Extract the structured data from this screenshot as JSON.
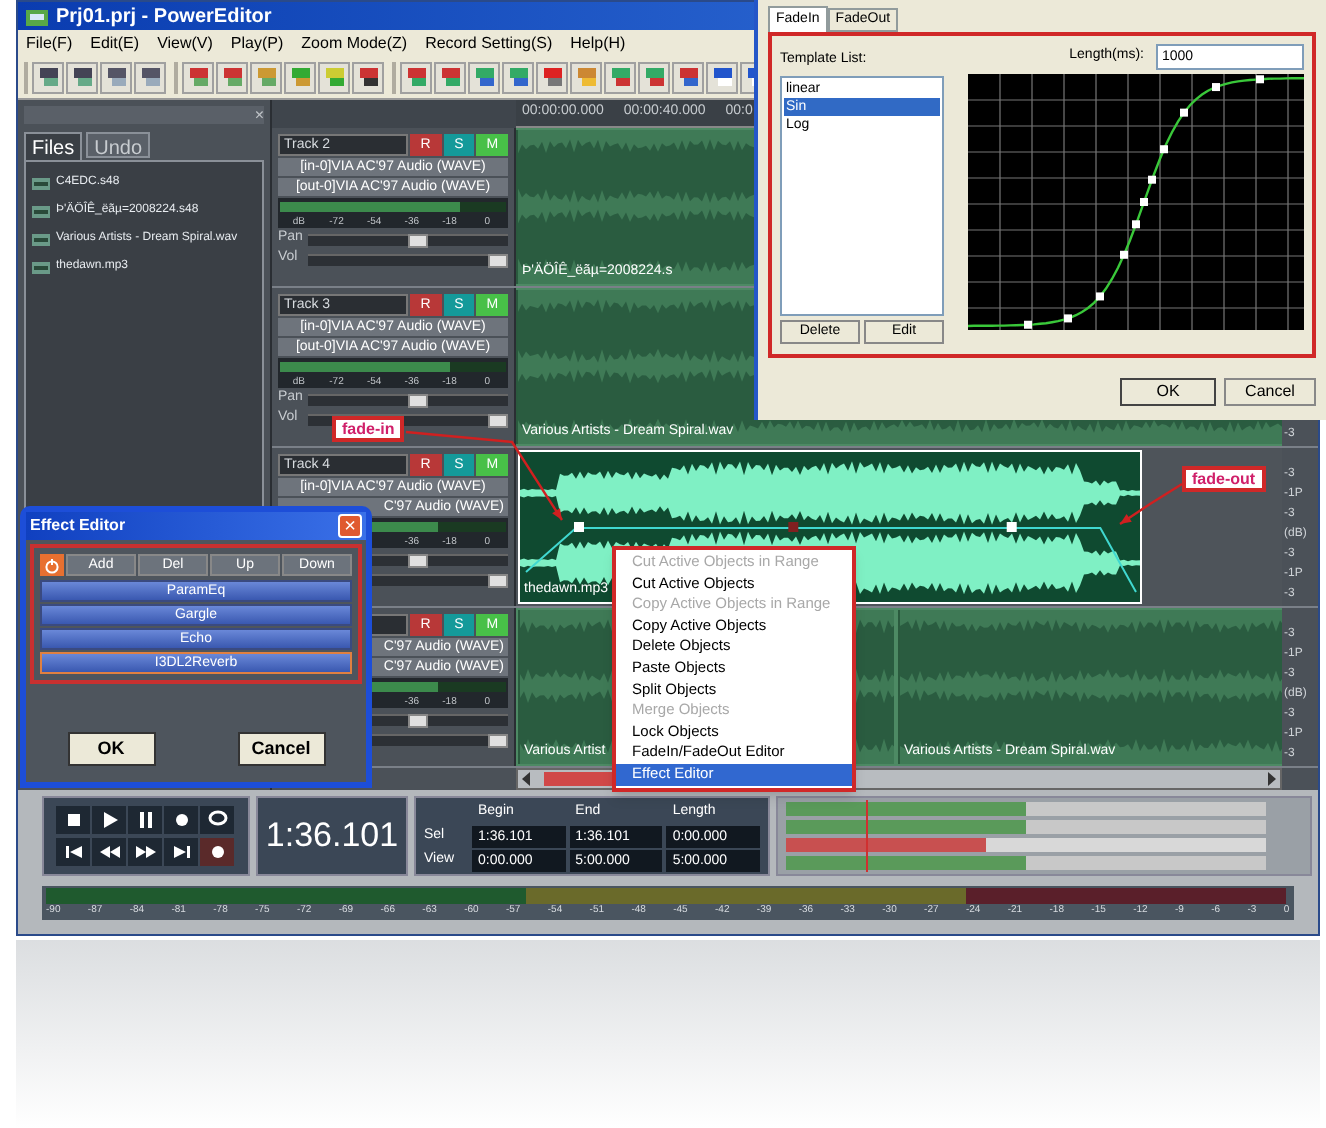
{
  "window": {
    "title": "Prj01.prj - PowerEditor"
  },
  "menu": [
    "File(F)",
    "Edit(E)",
    "View(V)",
    "Play(P)",
    "Zoom Mode(Z)",
    "Record Setting(S)",
    "Help(H)"
  ],
  "left_panel": {
    "close": "×",
    "tabs": [
      {
        "label": "Files",
        "selected": true
      },
      {
        "label": "Undo",
        "selected": false
      }
    ],
    "files": [
      "C4EDC.s48",
      "Þ'ÄÖÎÊ_ëãµ=2008224.s48",
      "Various Artists - Dream Spiral.wav",
      "thedawn.mp3"
    ]
  },
  "ruler": [
    "00:00:00.000",
    "00:00:40.000",
    "00:0"
  ],
  "tracks": [
    {
      "name": "Track 2",
      "buttons": [
        "R",
        "S",
        "M"
      ],
      "in": {
        "text": "[in-0]VIA AC'97 Audio (WAVE)",
        "cut": false
      },
      "out": {
        "text": "[out-0]VIA AC'97 Audio (WAVE)",
        "cut": false
      },
      "scale": [
        "dB",
        "-72",
        "-54",
        "-36",
        "-18",
        "0"
      ],
      "meter": {
        "level": 0.8
      },
      "pan": {
        "label": "Pan",
        "level": 0.55
      },
      "vol": {
        "label": "Vol",
        "level": 0.95
      },
      "clips": [
        {
          "label": "Þ'ÄÖÎÊ_ëãµ=2008224.s",
          "selected": false
        }
      ]
    },
    {
      "name": "Track 3",
      "buttons": [
        "R",
        "S",
        "M"
      ],
      "in": {
        "text": "[in-0]VIA AC'97 Audio (WAVE)",
        "cut": false
      },
      "out": {
        "text": "[out-0]VIA AC'97 Audio (WAVE)",
        "cut": false
      },
      "scale": [
        "dB",
        "-72",
        "-54",
        "-36",
        "-18",
        "0"
      ],
      "meter": {
        "level": 0.75
      },
      "pan": {
        "label": "Pan",
        "level": 0.55
      },
      "vol": {
        "label": "Vol",
        "level": 0.95
      },
      "clips": [
        {
          "label": "Various Artists - Dream Spiral.wav",
          "selected": false
        }
      ],
      "db_scale": [
        "-3"
      ]
    },
    {
      "name": "Track 4",
      "buttons": [
        "R",
        "S",
        "M"
      ],
      "in": {
        "text": "[in-0]VIA AC'97 Audio (WAVE)",
        "cut": false
      },
      "out": {
        "text": "C'97 Audio (WAVE)",
        "cut": true
      },
      "scale": [
        "-36",
        "-18",
        "0"
      ],
      "meter": {
        "level": 0.7
      },
      "pan": {
        "level": 0.55
      },
      "vol": {
        "level": 0.95
      },
      "clips": [
        {
          "label": "thedawn.mp3",
          "selected": true
        }
      ],
      "db_scale": [
        "-3",
        "-1P",
        "-3",
        "(dB)",
        "-3",
        "-1P",
        "-3"
      ]
    },
    {
      "buttons": [
        "R",
        "S",
        "M"
      ],
      "in": {
        "text": "C'97 Audio (WAVE)",
        "cut": true
      },
      "out": {
        "text": "C'97 Audio (WAVE)",
        "cut": true
      },
      "scale": [
        "-36",
        "-18",
        "0"
      ],
      "meter": {
        "level": 0.7
      },
      "pan": {
        "level": 0.55
      },
      "vol": {
        "level": 0.95
      },
      "clips": [
        {
          "label": "Various Artist",
          "selected": false
        },
        {
          "label": "Various Artists - Dream Spiral.wav",
          "selected": false
        }
      ],
      "db_scale": [
        "-3",
        "-1P",
        "-3",
        "(dB)",
        "-3",
        "-1P",
        "-3"
      ]
    }
  ],
  "context_menu": [
    {
      "label": "Cut Active Objects in Range",
      "disabled": true,
      "selected": false
    },
    {
      "label": "Cut Active Objects",
      "disabled": false,
      "selected": false
    },
    {
      "label": "Copy Active Objects in Range",
      "disabled": true,
      "selected": false
    },
    {
      "label": "Copy Active Objects",
      "disabled": false,
      "selected": false
    },
    {
      "label": "Delete Objects",
      "disabled": false,
      "selected": false
    },
    {
      "label": "Paste Objects",
      "disabled": false,
      "selected": false
    },
    {
      "label": "Split Objects",
      "disabled": false,
      "selected": false
    },
    {
      "label": "Merge Objects",
      "disabled": true,
      "selected": false
    },
    {
      "label": "Lock Objects",
      "disabled": false,
      "selected": false
    },
    {
      "label": "FadeIn/FadeOut Editor",
      "disabled": false,
      "selected": false
    },
    {
      "label": "Effect Editor",
      "disabled": false,
      "selected": true
    }
  ],
  "callouts": [
    "fade-in",
    "fade-out"
  ],
  "fade_dialog": {
    "tabs": [
      {
        "label": "FadeIn",
        "selected": true
      },
      {
        "label": "FadeOut",
        "selected": false
      }
    ],
    "template_label": "Template List:",
    "templates": [
      {
        "label": "linear",
        "selected": false
      },
      {
        "label": "Sin",
        "selected": true
      },
      {
        "label": "Log",
        "selected": false
      }
    ],
    "length_label": "Length(ms):",
    "length": "1000",
    "delete": "Delete",
    "edit": "Edit",
    "ok": "OK",
    "cancel": "Cancel"
  },
  "effect_editor": {
    "title": "Effect Editor",
    "close": "×",
    "tools": [
      "Add",
      "Del",
      "Up",
      "Down"
    ],
    "effects": [
      {
        "label": "ParamEq",
        "selected": false
      },
      {
        "label": "Gargle",
        "selected": false
      },
      {
        "label": "Echo",
        "selected": false
      },
      {
        "label": "I3DL2Reverb",
        "selected": true
      }
    ],
    "ok": "OK",
    "cancel": "Cancel"
  },
  "transport": {
    "time": "1:36.101",
    "columns": [
      "Begin",
      "End",
      "Length"
    ],
    "rows": [
      {
        "label": "Sel",
        "values": [
          "1:36.101",
          "1:36.101",
          "0:00.000"
        ]
      },
      {
        "label": "View",
        "values": [
          "0:00.000",
          "5:00.000",
          "5:00.000"
        ]
      }
    ]
  },
  "level_meter": {
    "scale": [
      "-90",
      "-87",
      "-84",
      "-81",
      "-78",
      "-75",
      "-72",
      "-69",
      "-66",
      "-63",
      "-60",
      "-57",
      "-54",
      "-51",
      "-48",
      "-45",
      "-42",
      "-39",
      "-36",
      "-33",
      "-30",
      "-27",
      "-24",
      "-21",
      "-18",
      "-15",
      "-12",
      "-9",
      "-6",
      "-3",
      "0"
    ]
  }
}
